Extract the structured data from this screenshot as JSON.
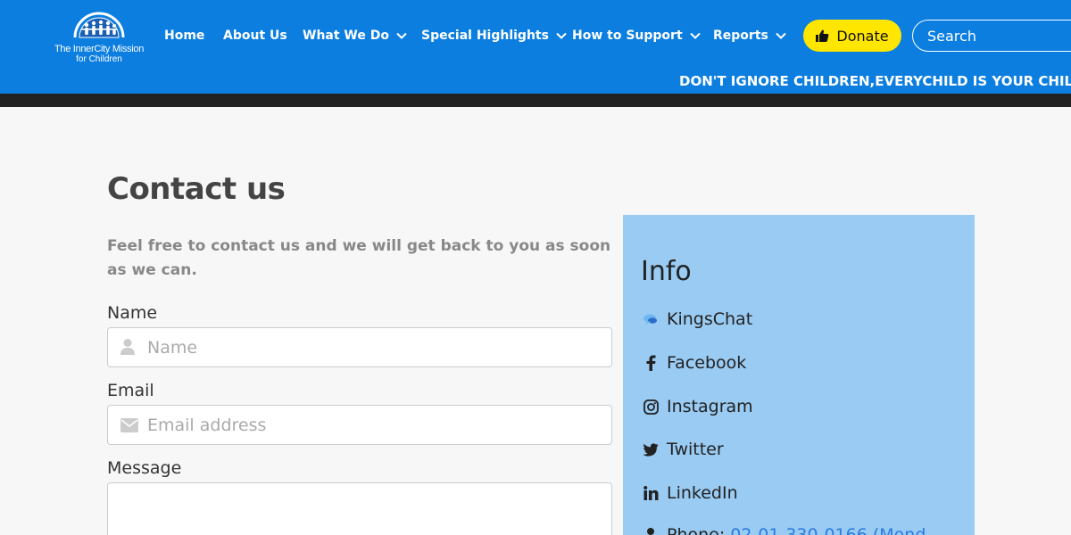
{
  "header": {
    "logo_line1": "The InnerCity Mission",
    "logo_line2": "for Children",
    "nav": [
      {
        "label": "Home"
      },
      {
        "label": "About Us"
      },
      {
        "label": "What We Do"
      },
      {
        "label": "Special Highlights"
      },
      {
        "label": "How to Support"
      },
      {
        "label": "Reports"
      }
    ],
    "donate_label": "Donate",
    "search_placeholder": "Search",
    "ticker": "DON'T IGNORE CHILDREN,EVERYCHILD IS YOUR CHILD, C",
    "brand_color": "#0b7ee0",
    "donate_color": "#ffe600"
  },
  "main": {
    "title": "Contact us",
    "intro": "Feel free to contact us and we will get back to you as soon as we can.",
    "name_label": "Name",
    "name_placeholder": "Name",
    "email_label": "Email",
    "email_placeholder": "Email address",
    "message_label": "Message"
  },
  "info": {
    "title": "Info",
    "panel_color": "#9acbf3",
    "items": [
      {
        "label": "KingsChat",
        "icon": "kingschat-icon"
      },
      {
        "label": "Facebook",
        "icon": "facebook-icon"
      },
      {
        "label": "Instagram",
        "icon": "instagram-icon"
      },
      {
        "label": "Twitter",
        "icon": "twitter-icon"
      },
      {
        "label": "LinkedIn",
        "icon": "linkedin-icon"
      }
    ],
    "phone_label": "Phone:",
    "phone_value": "02-01-330-0166 (Mond"
  }
}
